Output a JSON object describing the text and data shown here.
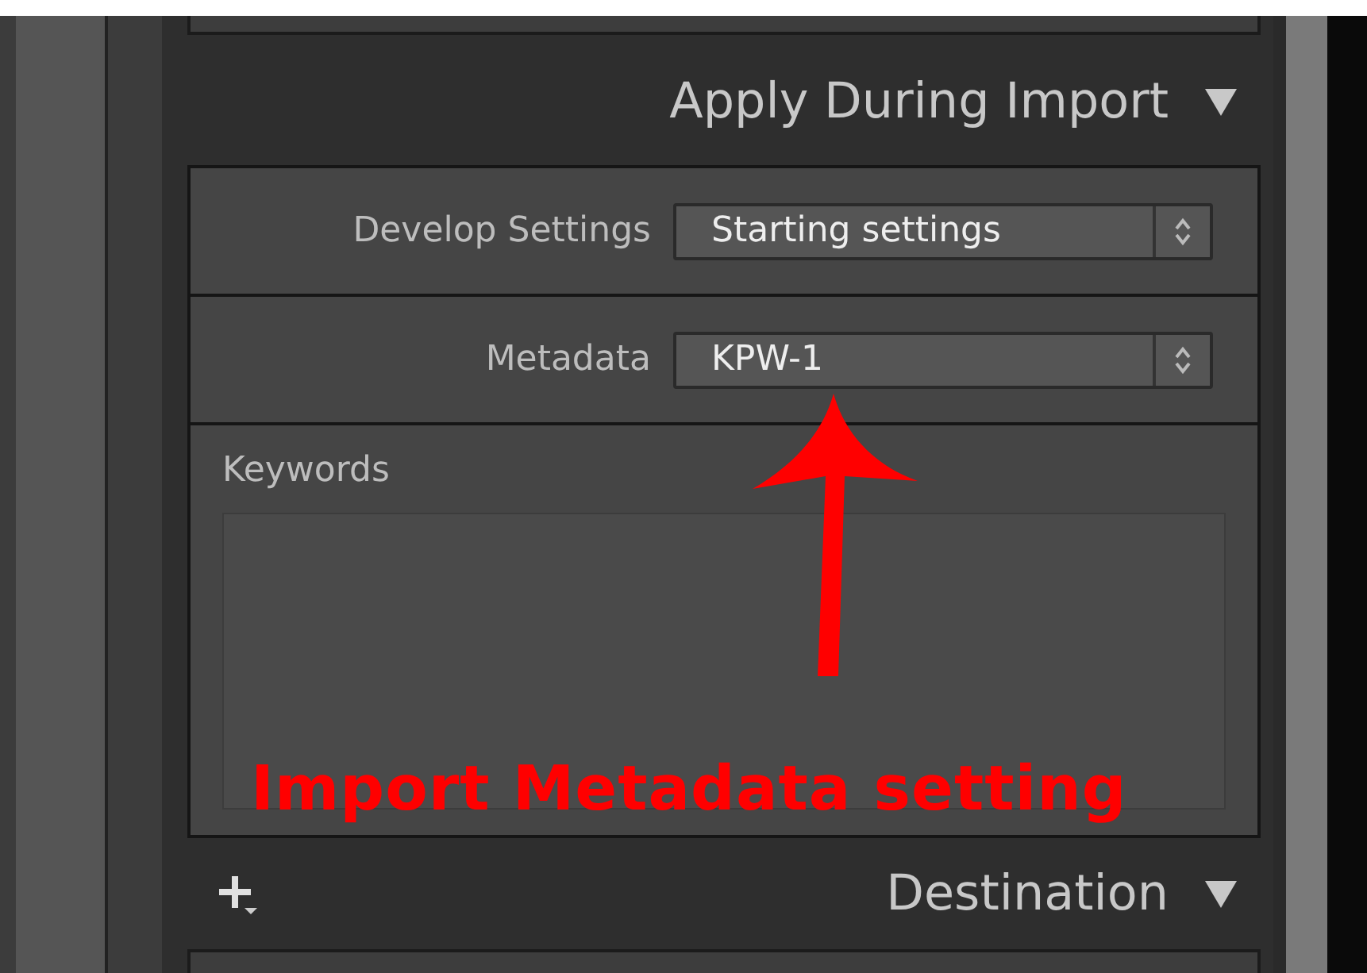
{
  "apply_panel": {
    "title": "Apply During Import",
    "expanded": true,
    "fields": [
      {
        "label": "Develop Settings",
        "value": "Starting settings"
      },
      {
        "label": "Metadata",
        "value": "KPW-1"
      }
    ],
    "keywords": {
      "label": "Keywords"
    }
  },
  "annotation": {
    "text": "Import Metadata setting"
  },
  "destination_panel": {
    "title": "Destination",
    "expanded": true
  }
}
